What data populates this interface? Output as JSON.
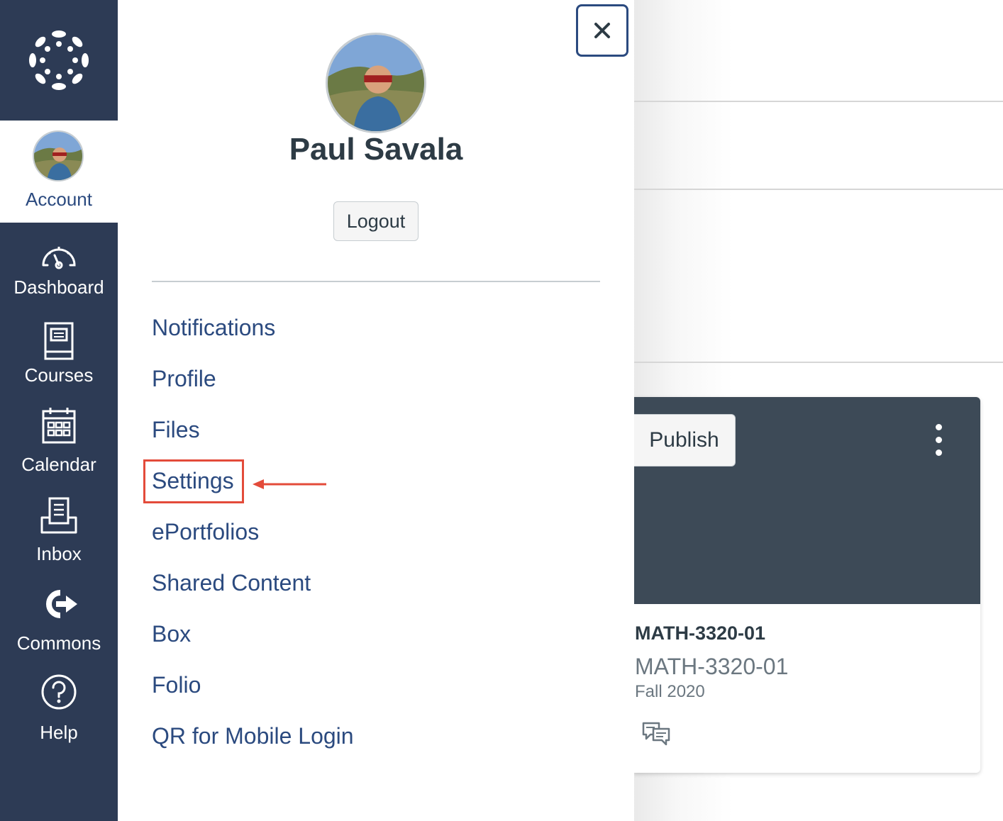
{
  "global_nav": {
    "account_label": "Account",
    "items": [
      {
        "label": "Dashboard",
        "icon": "dashboard-icon"
      },
      {
        "label": "Courses",
        "icon": "courses-icon"
      },
      {
        "label": "Calendar",
        "icon": "calendar-icon"
      },
      {
        "label": "Inbox",
        "icon": "inbox-icon"
      },
      {
        "label": "Commons",
        "icon": "commons-icon"
      },
      {
        "label": "Help",
        "icon": "help-icon"
      }
    ]
  },
  "tray": {
    "user_name": "Paul Savala",
    "logout_label": "Logout",
    "close_icon": "close-icon",
    "links": [
      {
        "label": "Notifications"
      },
      {
        "label": "Profile"
      },
      {
        "label": "Files"
      },
      {
        "label": "Settings",
        "highlighted": true
      },
      {
        "label": "ePortfolios"
      },
      {
        "label": "Shared Content"
      },
      {
        "label": "Box"
      },
      {
        "label": "Folio"
      },
      {
        "label": "QR for Mobile Login"
      }
    ]
  },
  "course_card": {
    "publish_label": "Publish",
    "code": "MATH-3320-01",
    "name": "MATH-3320-01",
    "term": "Fall 2020"
  },
  "colors": {
    "nav_bg": "#2d3b55",
    "link": "#2b4a7f",
    "highlight": "#e34b3a",
    "card_hero": "#3d4a57"
  }
}
